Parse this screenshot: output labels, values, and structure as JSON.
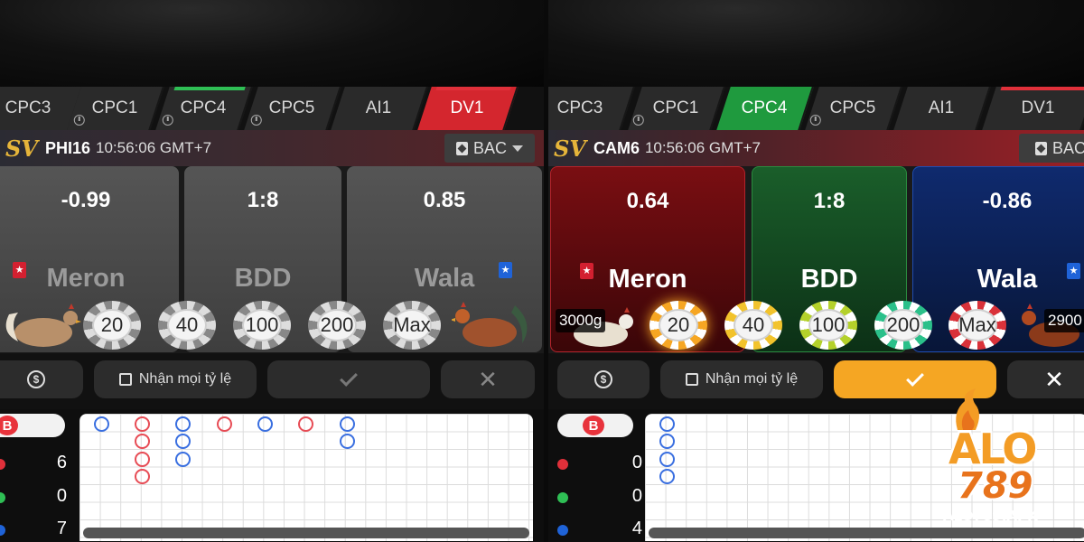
{
  "left": {
    "tabs": [
      {
        "label": "CPC3",
        "clock": false
      },
      {
        "label": "CPC1",
        "clock": true
      },
      {
        "label": "CPC4",
        "clock": true
      },
      {
        "label": "CPC5",
        "clock": true
      },
      {
        "label": "AI1",
        "clock": false
      },
      {
        "label": "DV1",
        "clock": false
      }
    ],
    "info": {
      "logo": "SV",
      "table": "PHI16",
      "time": "10:56:06 GMT+7",
      "game": "BAC"
    },
    "bets": {
      "meron": {
        "odds": "-0.99",
        "label": "Meron"
      },
      "bdd": {
        "odds": "1:8",
        "label": "BDD"
      },
      "wala": {
        "odds": "0.85",
        "label": "Wala"
      }
    },
    "chips": [
      "20",
      "40",
      "100",
      "200",
      "Max"
    ],
    "actions": {
      "accept_label": "Nhận mọi tỷ lệ"
    },
    "road": {
      "b_label": "B",
      "stats": [
        "6",
        "0",
        "7"
      ]
    }
  },
  "right": {
    "tabs": [
      {
        "label": "CPC3",
        "clock": false
      },
      {
        "label": "CPC1",
        "clock": true
      },
      {
        "label": "CPC4",
        "clock": false
      },
      {
        "label": "CPC5",
        "clock": true
      },
      {
        "label": "AI1",
        "clock": false
      },
      {
        "label": "DV1",
        "clock": false
      }
    ],
    "info": {
      "logo": "SV",
      "table": "CAM6",
      "time": "10:56:06 GMT+7",
      "game": "BAC"
    },
    "bets": {
      "meron": {
        "odds": "0.64",
        "label": "Meron"
      },
      "bdd": {
        "odds": "1:8",
        "label": "BDD"
      },
      "wala": {
        "odds": "-0.86",
        "label": "Wala"
      }
    },
    "chips": [
      "20",
      "40",
      "100",
      "200",
      "Max"
    ],
    "balance_left": "3000g",
    "balance_right": "2900",
    "actions": {
      "accept_label": "Nhận mọi tỷ lệ"
    },
    "road": {
      "b_label": "B",
      "stats": [
        "0",
        "0",
        "4"
      ]
    }
  },
  "brand": {
    "top": "ALO",
    "bottom": "789",
    "site": "ALO789.APK"
  },
  "colors": {
    "meron_red": "#d32030",
    "wala_blue": "#1f63d8",
    "bdd_green": "#1f9a3e",
    "accent_orange": "#f5a623"
  }
}
